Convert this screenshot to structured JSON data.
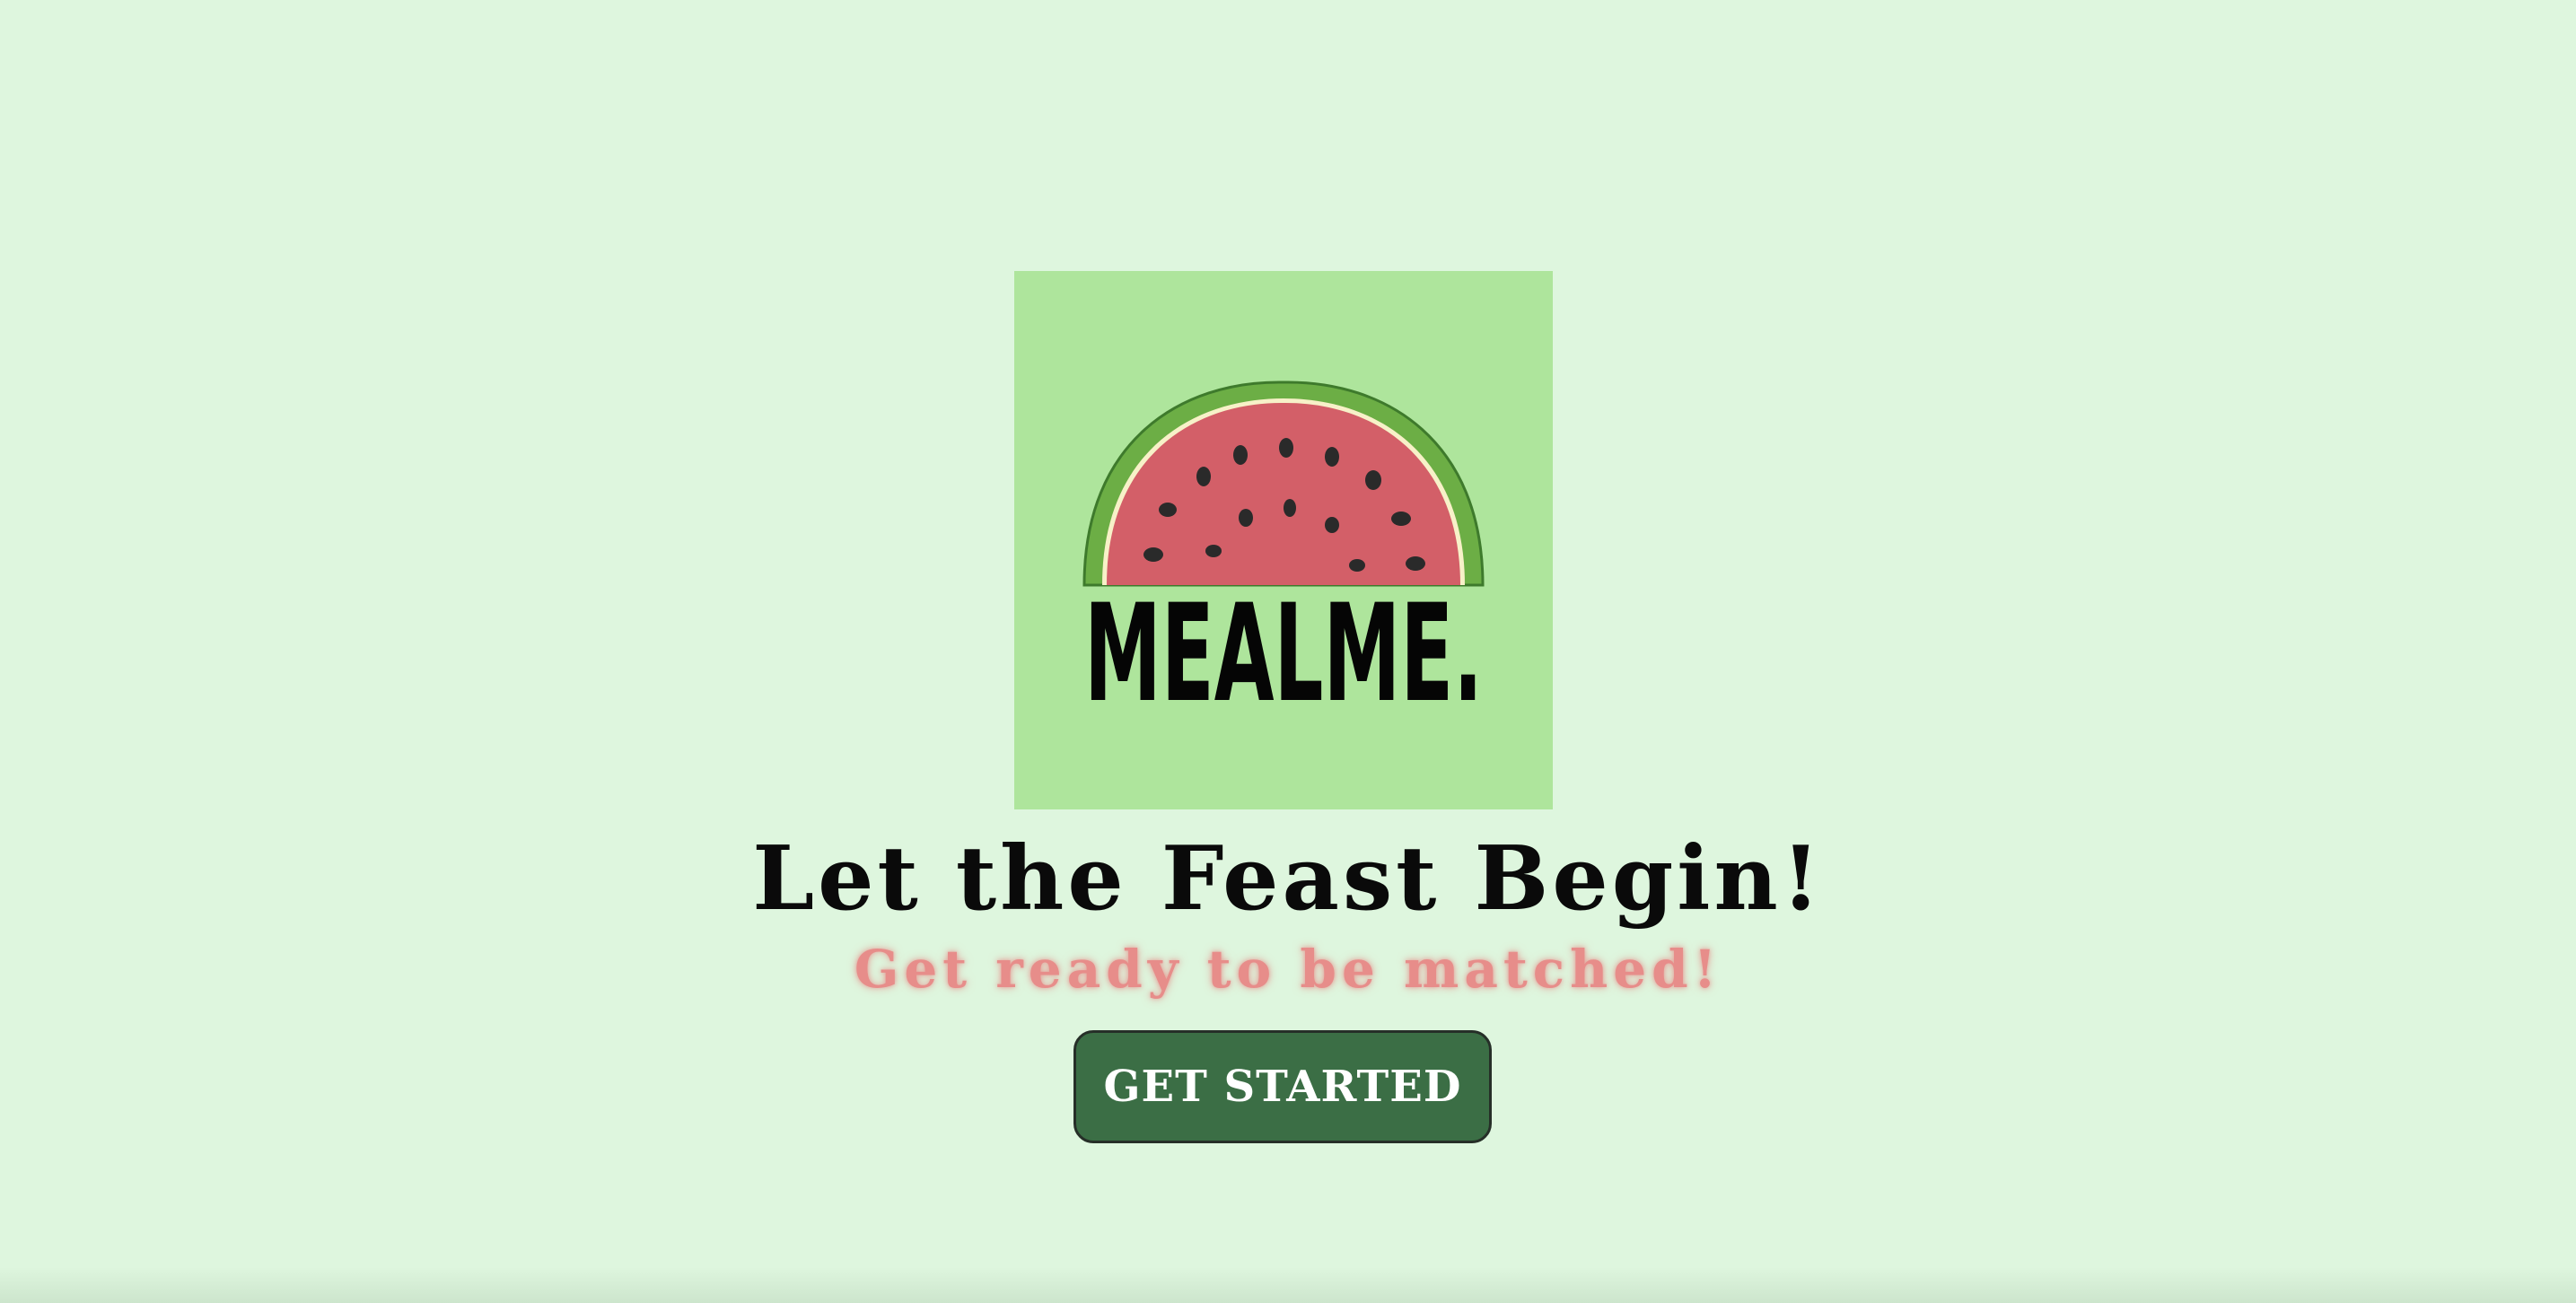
{
  "logo": {
    "wordmark": "MEALME.",
    "icon": "watermelon-slice-icon",
    "background_color": "#aee59c",
    "rind_color": "#6cae45",
    "flesh_color": "#d35f68",
    "seed_color": "#2a2a2a"
  },
  "hero": {
    "headline": "Let the Feast Begin!",
    "subheadline": "Get ready to be matched!"
  },
  "cta": {
    "label": "GET STARTED",
    "color": "#3b6e45"
  },
  "theme": {
    "page_background": "#def6de",
    "subheadline_color": "#e78d8a"
  }
}
